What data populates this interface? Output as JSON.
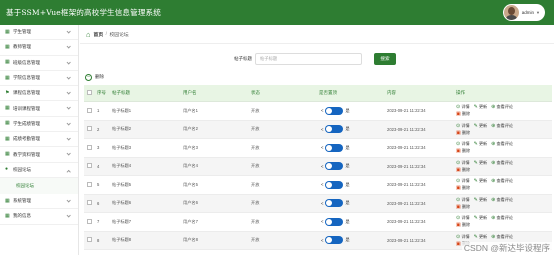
{
  "app": {
    "title": "基于SSM+Vue框架的高校学生信息管理系统",
    "user_name": "admin",
    "user_caret": "▼"
  },
  "sidebar": {
    "items": [
      {
        "label": "学生管理",
        "icon": "▦"
      },
      {
        "label": "教师管理",
        "icon": "▦"
      },
      {
        "label": "班级信息管理",
        "icon": "▦"
      },
      {
        "label": "学院信息管理",
        "icon": "▦"
      },
      {
        "label": "课程信息管理",
        "icon": "⚑"
      },
      {
        "label": "培训课程管理",
        "icon": "▦"
      },
      {
        "label": "学生成绩管理",
        "icon": "▦"
      },
      {
        "label": "成绩考勤管理",
        "icon": "▦"
      },
      {
        "label": "教学资料管理",
        "icon": "▦"
      },
      {
        "label": "校园论坛",
        "icon": "●",
        "open": true
      },
      {
        "label": "系统管理",
        "icon": "▦"
      },
      {
        "label": "我的信息",
        "icon": "▦"
      }
    ],
    "sub_item": "校园论坛"
  },
  "breadcrumb": {
    "home_icon": "⌂",
    "home": "首页",
    "separator": "/",
    "current": "校园论坛"
  },
  "search": {
    "label": "帖子标题",
    "placeholder": "帖子标题",
    "button": "搜索"
  },
  "toolbar": {
    "delete_label": "删除",
    "delete_icon": "−"
  },
  "table": {
    "headers": [
      "",
      "序号",
      "帖子标题",
      "用户名",
      "状态",
      "是否置顶",
      "内容",
      "操作"
    ],
    "toggle_left": "<",
    "toggle_right": "是",
    "ops": {
      "detail": "详情",
      "edit": "更新",
      "view": "查看评论",
      "delete": "删除"
    },
    "rows": [
      {
        "idx": "1",
        "title": "帖子标题1",
        "user": "用户名1",
        "status": "开放",
        "time": "2023-09-21 11:22:34"
      },
      {
        "idx": "2",
        "title": "帖子标题2",
        "user": "用户名2",
        "status": "开放",
        "time": "2023-09-21 11:22:34"
      },
      {
        "idx": "3",
        "title": "帖子标题3",
        "user": "用户名3",
        "status": "开放",
        "time": "2023-09-21 11:22:34"
      },
      {
        "idx": "4",
        "title": "帖子标题4",
        "user": "用户名4",
        "status": "开放",
        "time": "2023-09-21 11:22:34"
      },
      {
        "idx": "5",
        "title": "帖子标题5",
        "user": "用户名5",
        "status": "开放",
        "time": "2023-09-21 11:22:34"
      },
      {
        "idx": "6",
        "title": "帖子标题6",
        "user": "用户名6",
        "status": "开放",
        "time": "2023-09-21 11:22:34"
      },
      {
        "idx": "7",
        "title": "帖子标题7",
        "user": "用户名7",
        "status": "开放",
        "time": "2023-09-21 11:22:34"
      },
      {
        "idx": "8",
        "title": "帖子标题8",
        "user": "用户名8",
        "status": "开放",
        "time": "2023-09-21 11:22:34"
      }
    ]
  },
  "watermark": "CSDN @新达毕设程序",
  "colors": {
    "primary": "#2e7d32",
    "toggle": "#1565c0",
    "header_bg": "#e8f5e4",
    "danger": "#d84315"
  }
}
